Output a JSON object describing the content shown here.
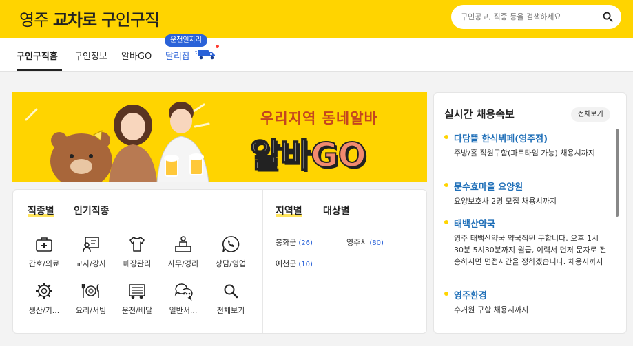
{
  "header": {
    "logo_word1": "영주",
    "logo_word2": "교차로",
    "logo_word3": "구인구직",
    "search_placeholder": "구인공고, 직종 등을 검색하세요"
  },
  "nav": {
    "items": [
      "구인구직홈",
      "구인정보",
      "알바GO",
      "달리잡"
    ],
    "badge": "운전일자리"
  },
  "banner": {
    "title1": "우리지역 동네알바",
    "title2_a": "알바",
    "title2_b": "GO"
  },
  "categories": {
    "tabs": [
      "직종별",
      "인기직종"
    ],
    "items": [
      {
        "label": "간호/의료",
        "icon": "medical-kit-icon"
      },
      {
        "label": "교사/강사",
        "icon": "teacher-board-icon"
      },
      {
        "label": "매장관리",
        "icon": "shirt-icon"
      },
      {
        "label": "사무/경리",
        "icon": "office-desk-icon"
      },
      {
        "label": "상담/영업",
        "icon": "phone-bubble-icon"
      },
      {
        "label": "생산/기...",
        "icon": "gear-icon"
      },
      {
        "label": "요리/서빙",
        "icon": "dish-cutlery-icon"
      },
      {
        "label": "운전/배달",
        "icon": "delivery-truck-icon"
      },
      {
        "label": "일반서...",
        "icon": "chat-bubbles-icon"
      },
      {
        "label": "전체보기",
        "icon": "search-icon"
      }
    ]
  },
  "regions": {
    "tabs": [
      "지역별",
      "대상별"
    ],
    "items": [
      {
        "name": "봉화군",
        "count": "(26)"
      },
      {
        "name": "영주시",
        "count": "(80)"
      },
      {
        "name": "예천군",
        "count": "(10)"
      }
    ]
  },
  "live_jobs": {
    "title": "실시간 채용속보",
    "see_all": "전체보기",
    "items": [
      {
        "title": "다담뜰 한식뷔페(영주점)",
        "desc": "주방/홀 직원구함(파트타임 가능) 채용시까지"
      },
      {
        "title": "문수효마을 요양원",
        "desc": "요양보호사 2명 모집 채용시까지"
      },
      {
        "title": "태백산약국",
        "desc": "영주 태백산약국 약국직원 구합니다. 오후 1시30분 5시30분까지 월급, 이력서 먼저 문자로 전송하시면 면접시간을 정하겠습니다. 채용시까지"
      },
      {
        "title": "영주환경",
        "desc": "수거원 구함 채용시까지"
      }
    ]
  },
  "colors": {
    "brand_yellow": "#ffd400",
    "accent_blue": "#2a62d8",
    "job_title_blue": "#1f6fb8"
  }
}
